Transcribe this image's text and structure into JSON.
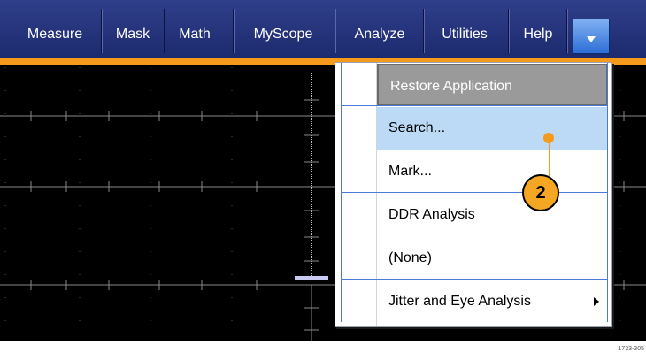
{
  "menubar": {
    "items": [
      {
        "label": "Measure"
      },
      {
        "label": "Mask"
      },
      {
        "label": "Math"
      },
      {
        "label": "MyScope"
      },
      {
        "label": "Analyze"
      },
      {
        "label": "Utilities"
      },
      {
        "label": "Help"
      }
    ]
  },
  "dropdown_button_icon": "chevron-down-icon",
  "analyze_menu": {
    "items": [
      {
        "label": "Restore Application"
      },
      {
        "label": "Search..."
      },
      {
        "label": "Mark..."
      },
      {
        "label": "DDR Analysis"
      },
      {
        "label": "(None)"
      },
      {
        "label": "Jitter and Eye Analysis"
      }
    ]
  },
  "callout": {
    "number": "2"
  },
  "figure_id": "1733-305",
  "colors": {
    "menubar": "#1c2a6e",
    "accent": "#f59a1a",
    "highlight": "#bcdaf5",
    "restore": "#9a9a9a"
  }
}
